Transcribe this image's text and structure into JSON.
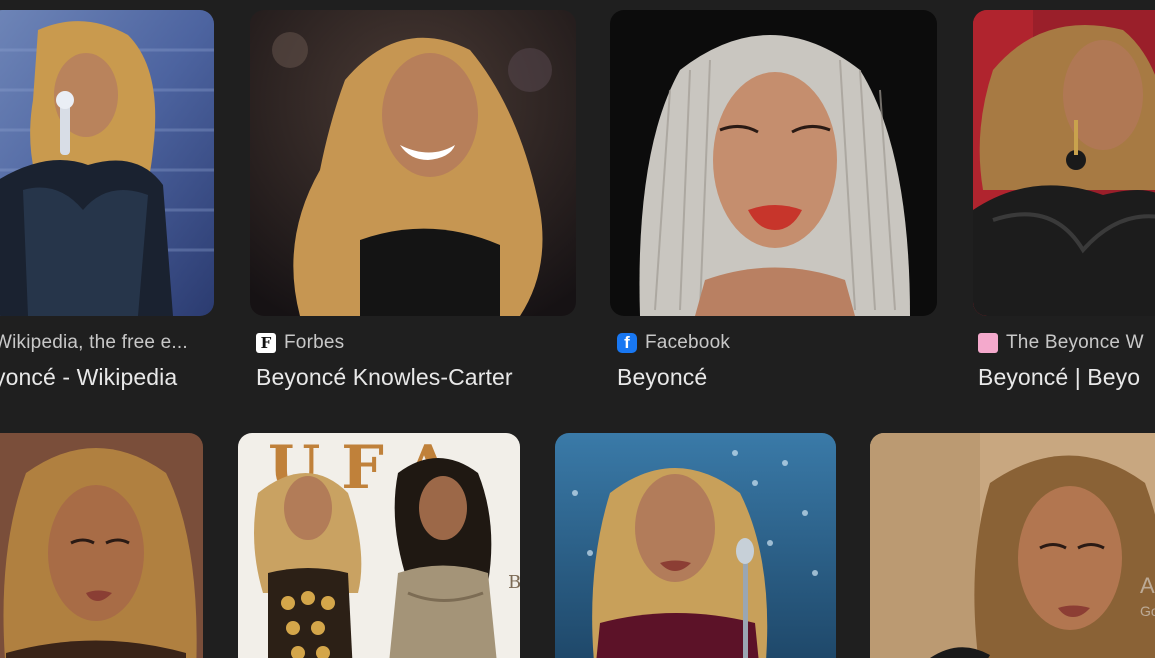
{
  "results_row1": [
    {
      "source": "Wikipedia, the free e...",
      "title": "yoncé - Wikipedia",
      "favicon": "none"
    },
    {
      "source": "Forbes",
      "title": "Beyoncé Knowles-Carter",
      "favicon": "forbes-icon"
    },
    {
      "source": "Facebook",
      "title": "Beyoncé",
      "favicon": "facebook-icon"
    },
    {
      "source": "The Beyonce W",
      "title": "Beyoncé | Beyo",
      "favicon": "pink-square-icon"
    }
  ],
  "results_row2_partial_text": "A",
  "results_row2_partial_text_2": "Go",
  "colors": {
    "background": "#1f1f1f",
    "source_text": "#c8c8c8",
    "title_text": "#e8e8e8",
    "facebook_blue": "#1877f2"
  }
}
